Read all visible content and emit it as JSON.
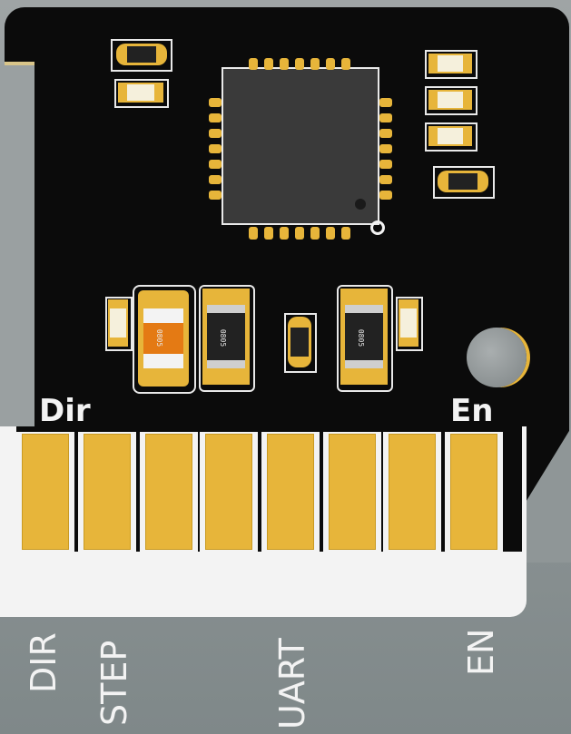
{
  "board": {
    "top_labels": {
      "left": "Dir",
      "right": "En"
    },
    "bottom_labels": [
      "DIR",
      "STEP",
      "UART",
      "EN"
    ],
    "resistor_markings": [
      "0805",
      "0805",
      "0805"
    ],
    "colors": {
      "board": "#0b0b0b",
      "copper": "#e7b53a",
      "silkscreen": "#f3f3f3",
      "background": "#9aa0a1"
    }
  }
}
